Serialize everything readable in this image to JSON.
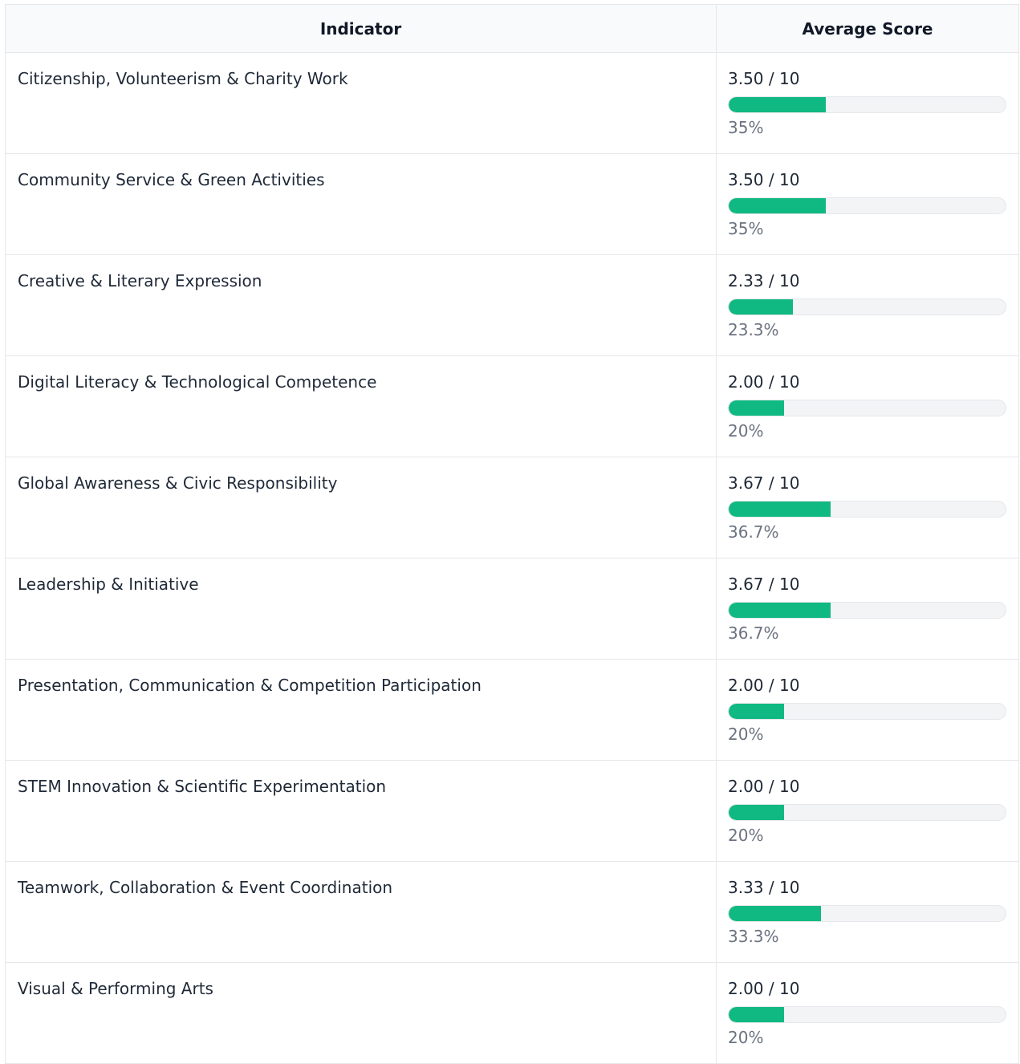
{
  "table": {
    "headers": {
      "indicator": "Indicator",
      "score": "Average Score"
    },
    "accent_color": "#10b981",
    "rows": [
      {
        "indicator": "Citizenship, Volunteerism & Charity Work",
        "score": "3.50 / 10",
        "percent_label": "35%",
        "fraction": 0.35
      },
      {
        "indicator": "Community Service & Green Activities",
        "score": "3.50 / 10",
        "percent_label": "35%",
        "fraction": 0.35
      },
      {
        "indicator": "Creative & Literary Expression",
        "score": "2.33 / 10",
        "percent_label": "23.3%",
        "fraction": 0.233
      },
      {
        "indicator": "Digital Literacy & Technological Competence",
        "score": "2.00 / 10",
        "percent_label": "20%",
        "fraction": 0.2
      },
      {
        "indicator": "Global Awareness & Civic Responsibility",
        "score": "3.67 / 10",
        "percent_label": "36.7%",
        "fraction": 0.367
      },
      {
        "indicator": "Leadership & Initiative",
        "score": "3.67 / 10",
        "percent_label": "36.7%",
        "fraction": 0.367
      },
      {
        "indicator": "Presentation, Communication & Competition Participation",
        "score": "2.00 / 10",
        "percent_label": "20%",
        "fraction": 0.2
      },
      {
        "indicator": "STEM Innovation & Scientific Experimentation",
        "score": "2.00 / 10",
        "percent_label": "20%",
        "fraction": 0.2
      },
      {
        "indicator": "Teamwork, Collaboration & Event Coordination",
        "score": "3.33 / 10",
        "percent_label": "33.3%",
        "fraction": 0.333
      },
      {
        "indicator": "Visual & Performing Arts",
        "score": "2.00 / 10",
        "percent_label": "20%",
        "fraction": 0.2
      }
    ]
  }
}
